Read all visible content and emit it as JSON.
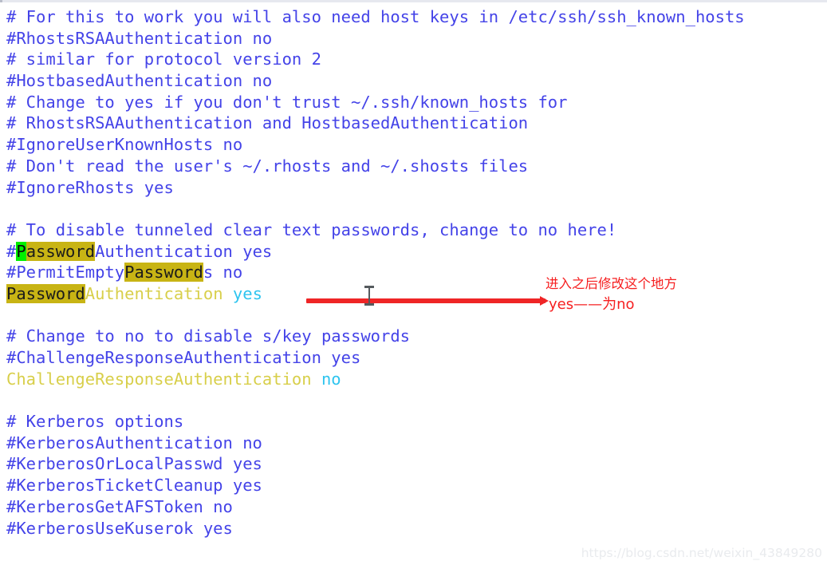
{
  "document": {
    "title": "sshd_config",
    "colors": {
      "background": "#ffffff",
      "comment": "#4443e8",
      "directive_key": "#d8cf4a",
      "directive_value": "#2ec4ef",
      "search_highlight": "#c8b414",
      "search_current": "#00ef00",
      "annotation": "#f61f20",
      "watermark": "#e9ebee"
    },
    "lines": [
      {
        "id": "l1",
        "type": "comment",
        "text": "# For this to work you will also need host keys in /etc/ssh/ssh_known_hosts"
      },
      {
        "id": "l2",
        "type": "comment",
        "text": "#RhostsRSAAuthentication no"
      },
      {
        "id": "l3",
        "type": "comment",
        "text": "# similar for protocol version 2"
      },
      {
        "id": "l4",
        "type": "comment",
        "text": "#HostbasedAuthentication no"
      },
      {
        "id": "l5",
        "type": "comment",
        "text": "# Change to yes if you don't trust ~/.ssh/known_hosts for"
      },
      {
        "id": "l6",
        "type": "comment",
        "text": "# RhostsRSAAuthentication and HostbasedAuthentication"
      },
      {
        "id": "l7",
        "type": "comment",
        "text": "#IgnoreUserKnownHosts no"
      },
      {
        "id": "l8",
        "type": "comment",
        "text": "# Don't read the user's ~/.rhosts and ~/.shosts files"
      },
      {
        "id": "l9",
        "type": "comment",
        "text": "#IgnoreRhosts yes"
      },
      {
        "id": "l10",
        "type": "blank",
        "text": ""
      },
      {
        "id": "l11",
        "type": "comment",
        "text": "# To disable tunneled clear text passwords, change to no here!"
      },
      {
        "id": "l12",
        "type": "comment-highlight",
        "segments": [
          {
            "style": "cmt",
            "text": "#"
          },
          {
            "style": "hl-cur",
            "text": "P"
          },
          {
            "style": "hl",
            "text": "assword"
          },
          {
            "style": "cmt",
            "text": "Authentication yes"
          }
        ],
        "text": "#PasswordAuthentication yes"
      },
      {
        "id": "l13",
        "type": "comment-highlight",
        "segments": [
          {
            "style": "cmt",
            "text": "#PermitEmpty"
          },
          {
            "style": "hl",
            "text": "Password"
          },
          {
            "style": "cmt",
            "text": "s no"
          }
        ],
        "text": "#PermitEmptyPasswords no"
      },
      {
        "id": "l14",
        "type": "directive-highlight",
        "segments": [
          {
            "style": "hl",
            "text": "Password"
          },
          {
            "style": "key",
            "text": "Authentication "
          },
          {
            "style": "val",
            "text": "yes"
          }
        ],
        "text": "PasswordAuthentication yes"
      },
      {
        "id": "l15",
        "type": "blank",
        "text": ""
      },
      {
        "id": "l16",
        "type": "comment",
        "text": "# Change to no to disable s/key passwords"
      },
      {
        "id": "l17",
        "type": "comment",
        "text": "#ChallengeResponseAuthentication yes"
      },
      {
        "id": "l18",
        "type": "directive",
        "segments": [
          {
            "style": "key",
            "text": "ChallengeResponseAuthentication "
          },
          {
            "style": "val",
            "text": "no"
          }
        ],
        "text": "ChallengeResponseAuthentication no"
      },
      {
        "id": "l19",
        "type": "blank",
        "text": ""
      },
      {
        "id": "l20",
        "type": "comment",
        "text": "# Kerberos options"
      },
      {
        "id": "l21",
        "type": "comment",
        "text": "#KerberosAuthentication no"
      },
      {
        "id": "l22",
        "type": "comment",
        "text": "#KerberosOrLocalPasswd yes"
      },
      {
        "id": "l23",
        "type": "comment",
        "text": "#KerberosTicketCleanup yes"
      },
      {
        "id": "l24",
        "type": "comment",
        "text": "#KerberosGetAFSToken no"
      },
      {
        "id": "l25",
        "type": "comment",
        "text": "#KerberosUseKuserok yes"
      }
    ]
  },
  "annotations": {
    "top_note": "进入之后修改这个地方",
    "bottom_note": "yes——为no",
    "arrow": {
      "color": "#ef2526",
      "direction": "right",
      "points_to_line": "l14"
    }
  },
  "cursor": {
    "type": "i-beam-text-cursor"
  },
  "watermark": {
    "text": "https://blog.csdn.net/weixin_43849280"
  }
}
